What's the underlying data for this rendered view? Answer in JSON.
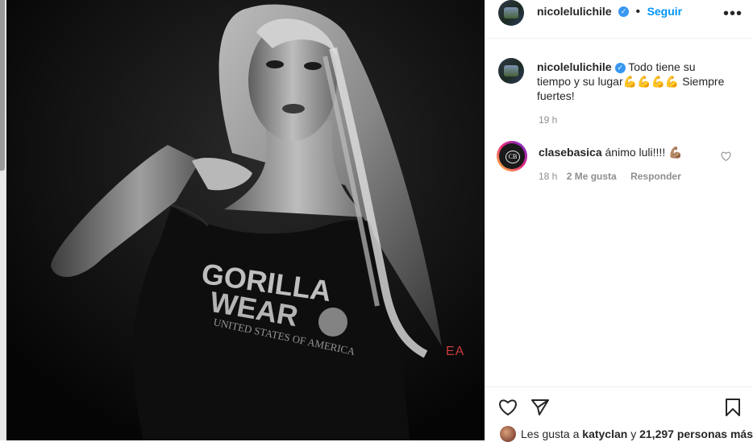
{
  "post": {
    "watermark": "EA"
  },
  "header": {
    "username": "nicolelulichile",
    "follow_label": "Seguir",
    "more_label": "•••"
  },
  "caption": {
    "username": "nicolelulichile",
    "text_part1": "Todo tiene su tiempo y su lugar",
    "emojis": "💪💪💪💪",
    "text_part2": "Siempre fuertes!",
    "time": "19 h"
  },
  "comments": [
    {
      "username": "clasebasica",
      "text": "ánimo luli!!!!",
      "emoji": "💪🏽",
      "time": "18 h",
      "likes": "2 Me gusta",
      "reply_label": "Responder"
    }
  ],
  "footer": {
    "likes_prefix": "Les gusta a",
    "liker": "katyclan",
    "likes_middle": "y",
    "likes_count": "21,297 personas más"
  }
}
